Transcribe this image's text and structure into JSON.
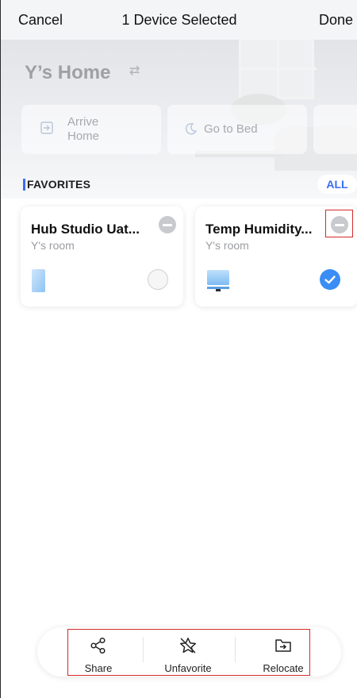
{
  "header": {
    "cancel_label": "Cancel",
    "title": "1 Device Selected",
    "done_label": "Done"
  },
  "home": {
    "title": "Y’s Home",
    "scenes": [
      {
        "label_line1": "Arrive",
        "label_line2": "Home",
        "icon": "arrive-home-icon"
      },
      {
        "label_line1": "Go to Bed",
        "label_line2": "",
        "icon": "moon-icon"
      }
    ]
  },
  "favorites": {
    "label": "FAVORITES",
    "all_label": "ALL",
    "devices": [
      {
        "name": "Hub Studio Uat...",
        "room": "Y's room",
        "selected": false,
        "icon": "hub-device-icon"
      },
      {
        "name": "Temp Humidity...",
        "room": "Y's room",
        "selected": true,
        "icon": "temp-humidity-device-icon"
      }
    ]
  },
  "toolbar": {
    "items": [
      {
        "label": "Share",
        "icon": "share-icon"
      },
      {
        "label": "Unfavorite",
        "icon": "unfavorite-star-icon"
      },
      {
        "label": "Relocate",
        "icon": "relocate-icon"
      }
    ]
  },
  "colors": {
    "accent": "#3a6cf4",
    "selected": "#3a8df5",
    "highlight": "#d42a2a"
  }
}
